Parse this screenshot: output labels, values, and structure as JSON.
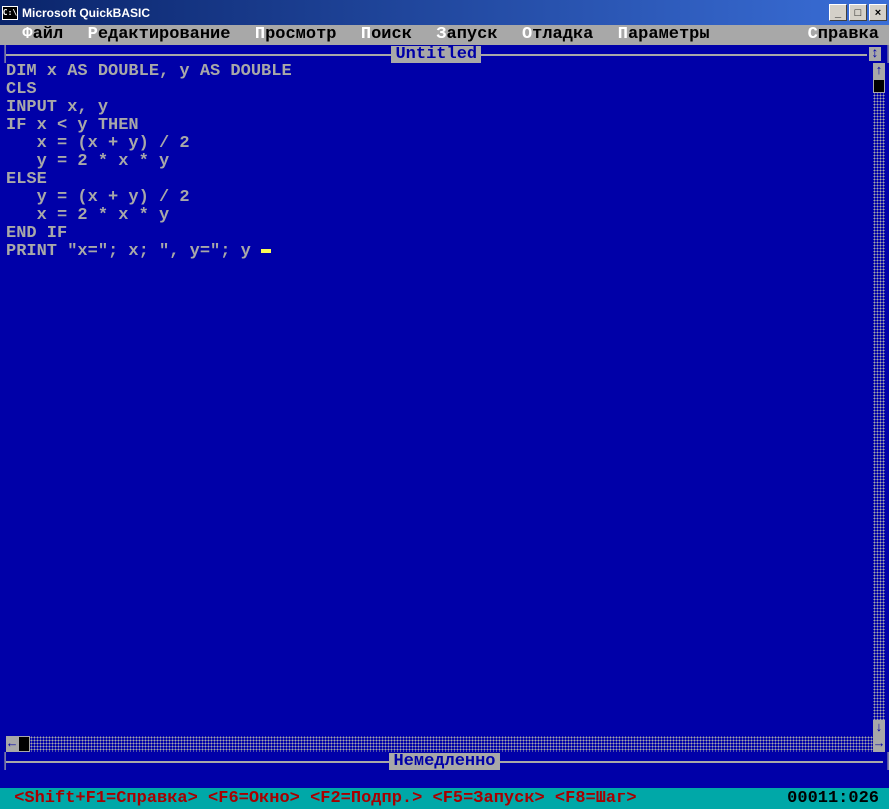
{
  "window": {
    "title": "Microsoft QuickBASIC",
    "icon_text": "C:\\"
  },
  "menubar": {
    "items": [
      {
        "hotkey": "Ф",
        "rest": "айл"
      },
      {
        "hotkey": "Р",
        "rest": "едактирование"
      },
      {
        "hotkey": "П",
        "rest": "росмотр"
      },
      {
        "hotkey": "П",
        "rest": "оиск"
      },
      {
        "hotkey": "З",
        "rest": "апуск"
      },
      {
        "hotkey": "О",
        "rest": "тладка"
      },
      {
        "hotkey": "П",
        "rest": "араметры"
      }
    ],
    "help": {
      "hotkey": "С",
      "rest": "правка"
    }
  },
  "editor": {
    "title": "Untitled",
    "maximize_char": "↕",
    "code_lines": [
      "DIM x AS DOUBLE, y AS DOUBLE",
      "CLS",
      "INPUT x, y",
      "IF x < y THEN",
      "   x = (x + y) / 2",
      "   y = 2 * x * y",
      "ELSE",
      "   y = (x + y) / 2",
      "   x = 2 * x * y",
      "END IF",
      "PRINT \"x=\"; x; \", y=\"; y"
    ]
  },
  "immediate": {
    "label": "Немедленно"
  },
  "statusbar": {
    "hints": [
      "<Shift+F1=Справка>",
      "<F6=Окно>",
      "<F2=Подпр.>",
      "<F5=Запуск>",
      "<F8=Шаг>"
    ],
    "position": "00011:026"
  },
  "titlebar_buttons": {
    "minimize": "_",
    "maximize": "□",
    "close": "×"
  }
}
